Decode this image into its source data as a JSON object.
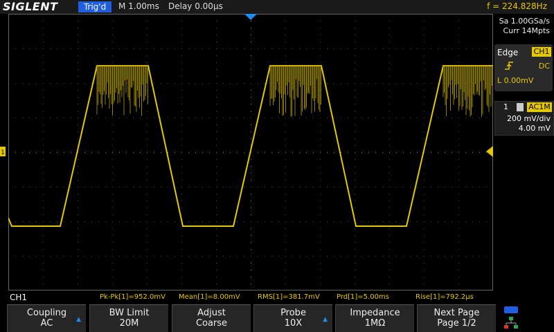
{
  "header": {
    "brand": "SIGLENT",
    "trigger_status": "Trig'd",
    "timebase": "M 1.00ms",
    "delay": "Delay 0.00µs",
    "frequency": "f = 224.828Hz"
  },
  "acquisition": {
    "sample_rate": "Sa 1.00GSa/s",
    "memory_depth": "Curr 14Mpts"
  },
  "trigger_panel": {
    "type": "Edge",
    "source": "CH1",
    "coupling": "DC",
    "level": "L  0.00mV"
  },
  "channel_panel": {
    "number": "1",
    "coupling": "AC1M",
    "volts_div": "200 mV/div",
    "offset": "4.00 mV"
  },
  "channel_label": "CH1",
  "measurements": [
    "Pk-Pk[1]=952.0mV",
    "Mean[1]=8.00mV",
    "RMS[1]=381.7mV",
    "Prd[1]=5.00ms",
    "Rise[1]=792.2µs"
  ],
  "softkeys": [
    {
      "line1": "Coupling",
      "line2": "AC",
      "has_arrow": true
    },
    {
      "line1": "BW Limit",
      "line2": "20M",
      "has_arrow": false
    },
    {
      "line1": "Adjust",
      "line2": "Coarse",
      "has_arrow": false
    },
    {
      "line1": "Probe",
      "line2": "10X",
      "has_arrow": true
    },
    {
      "line1": "Impedance",
      "line2": "1MΩ",
      "has_arrow": false
    },
    {
      "line1": "Next Page",
      "line2": "Page 1/2",
      "has_arrow": false
    }
  ],
  "colors": {
    "trace": "#e5c800",
    "accent": "#1f5ee0",
    "grid": "#555555"
  },
  "icons": [
    "usb-icon",
    "network-icon",
    "trigger-edge-rising-icon",
    "trigger-position-marker-icon",
    "channel-ground-marker-icon",
    "trigger-level-marker-icon"
  ]
}
